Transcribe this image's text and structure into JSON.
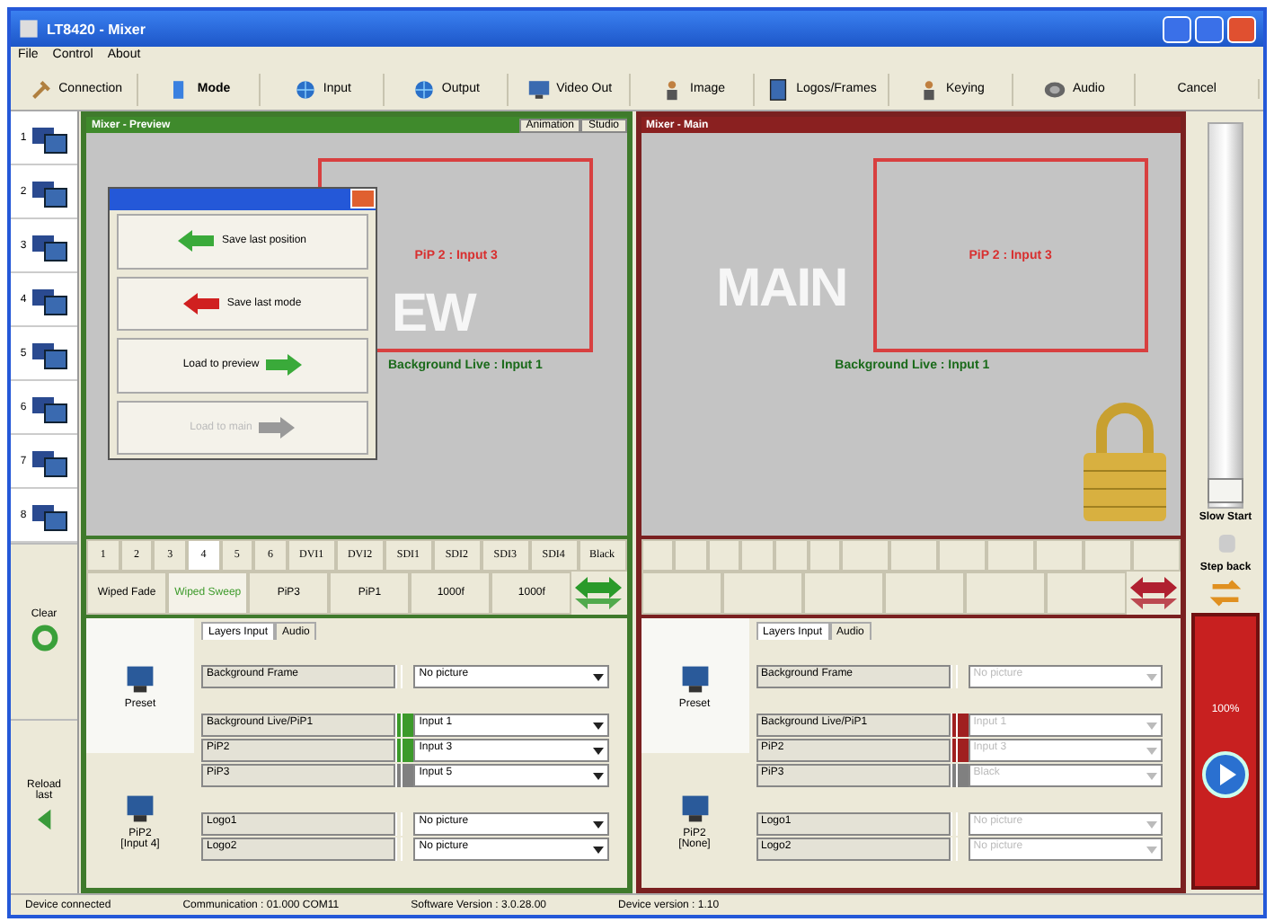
{
  "window": {
    "title": "LT8420 - Mixer"
  },
  "menu": [
    "File",
    "Control",
    "About"
  ],
  "toolbar": [
    {
      "label": "Connection",
      "bold": false
    },
    {
      "label": "Mode",
      "bold": true
    },
    {
      "label": "Input",
      "bold": false
    },
    {
      "label": "Output",
      "bold": false
    },
    {
      "label": "Video Out",
      "bold": false
    },
    {
      "label": "Image",
      "bold": false
    },
    {
      "label": "Logos/Frames",
      "bold": false
    },
    {
      "label": "Keying",
      "bold": false
    },
    {
      "label": "Audio",
      "bold": false
    },
    {
      "label": "Cancel",
      "bold": false
    }
  ],
  "presets": [
    "1",
    "2",
    "3",
    "4",
    "5",
    "6",
    "7",
    "8"
  ],
  "side_actions": [
    {
      "label": "Clear",
      "kind": "recycle"
    },
    {
      "label": "Reload last",
      "kind": "back"
    }
  ],
  "panels": [
    {
      "kind": "preview",
      "title": "Mixer - Preview",
      "header_buttons": [
        "Animation",
        "Studio"
      ],
      "pip_label": "PiP 2 : Input 3",
      "live_label": "Background Live : Input 1",
      "monitor_text": "EW",
      "locked": false,
      "disabled": false,
      "inputs": [
        {
          "label": "1",
          "selected": false
        },
        {
          "label": "2",
          "selected": false
        },
        {
          "label": "3",
          "selected": false
        },
        {
          "label": "4",
          "selected": true
        },
        {
          "label": "5",
          "selected": false
        },
        {
          "label": "6",
          "selected": false
        },
        {
          "label": "DVI1",
          "selected": false
        },
        {
          "label": "DVI2",
          "selected": false
        },
        {
          "label": "SDI1",
          "selected": false
        },
        {
          "label": "SDI2",
          "selected": false
        },
        {
          "label": "SDI3",
          "selected": false
        },
        {
          "label": "SDI4",
          "selected": false
        },
        {
          "label": "Black",
          "selected": false
        }
      ],
      "effects": [
        {
          "label": "Wiped Fade",
          "selected": false
        },
        {
          "label": "Wiped Sweep",
          "selected": true
        },
        {
          "label": "PiP3",
          "selected": false
        },
        {
          "label": "PiP1",
          "selected": false
        },
        {
          "label": "1000f",
          "selected": false
        },
        {
          "label": "1000f",
          "selected": false
        }
      ],
      "tabs": [
        {
          "label": "Layers Input",
          "selected": true
        },
        {
          "label": "Audio",
          "selected": false
        }
      ],
      "presets": [
        {
          "label": "Preset",
          "selected": true
        },
        {
          "label": "PiP2\n[Input 4]",
          "selected": false
        }
      ],
      "layers": [
        {
          "label": "Background Frame",
          "value": "No picture"
        },
        {
          "label": "Background Live/PiP1",
          "value": "Input 1",
          "color": "#3c9a2a"
        },
        {
          "label": "PiP2",
          "value": "Input 3",
          "color": "#3c9a2a"
        },
        {
          "label": "PiP3",
          "value": "Input 5",
          "color": "#808080"
        },
        {
          "label": "Logo1",
          "value": "No picture"
        },
        {
          "label": "Logo2",
          "value": "No picture"
        }
      ]
    },
    {
      "kind": "main",
      "title": "Mixer - Main",
      "pip_label": "PiP 2 : Input 3",
      "live_label": "Background Live : Input 1",
      "monitor_text": "MAIN",
      "locked": true,
      "disabled": true,
      "tabs": [
        {
          "label": "Layers Input",
          "selected": true
        },
        {
          "label": "Audio",
          "selected": false
        }
      ],
      "presets": [
        {
          "label": "Preset",
          "selected": true
        },
        {
          "label": "PiP2\n[None]",
          "selected": false
        }
      ],
      "layers": [
        {
          "label": "Background Frame",
          "value": "No picture"
        },
        {
          "label": "Background Live/PiP1",
          "value": "Input 1",
          "color": "#a02020"
        },
        {
          "label": "PiP2",
          "value": "Input 3",
          "color": "#a02020"
        },
        {
          "label": "PiP3",
          "value": "Black",
          "color": "#808080"
        },
        {
          "label": "Logo1",
          "value": "No picture"
        },
        {
          "label": "Logo2",
          "value": "No picture"
        }
      ]
    }
  ],
  "popup": {
    "items": [
      {
        "label": "Save last position",
        "disabled": false
      },
      {
        "label": "Save last mode",
        "disabled": false
      },
      {
        "label": "Load to preview",
        "disabled": false
      },
      {
        "label": "Load to main",
        "disabled": true
      }
    ]
  },
  "transition": {
    "level": 0.02,
    "slow_label": "Slow Start",
    "step_label": "Step back",
    "take_label": "100%"
  },
  "status_bar": [
    "Device connected",
    "Communication : 01.000 COM11",
    "Software Version : 3.0.28.00",
    "Device version : 1.10"
  ]
}
